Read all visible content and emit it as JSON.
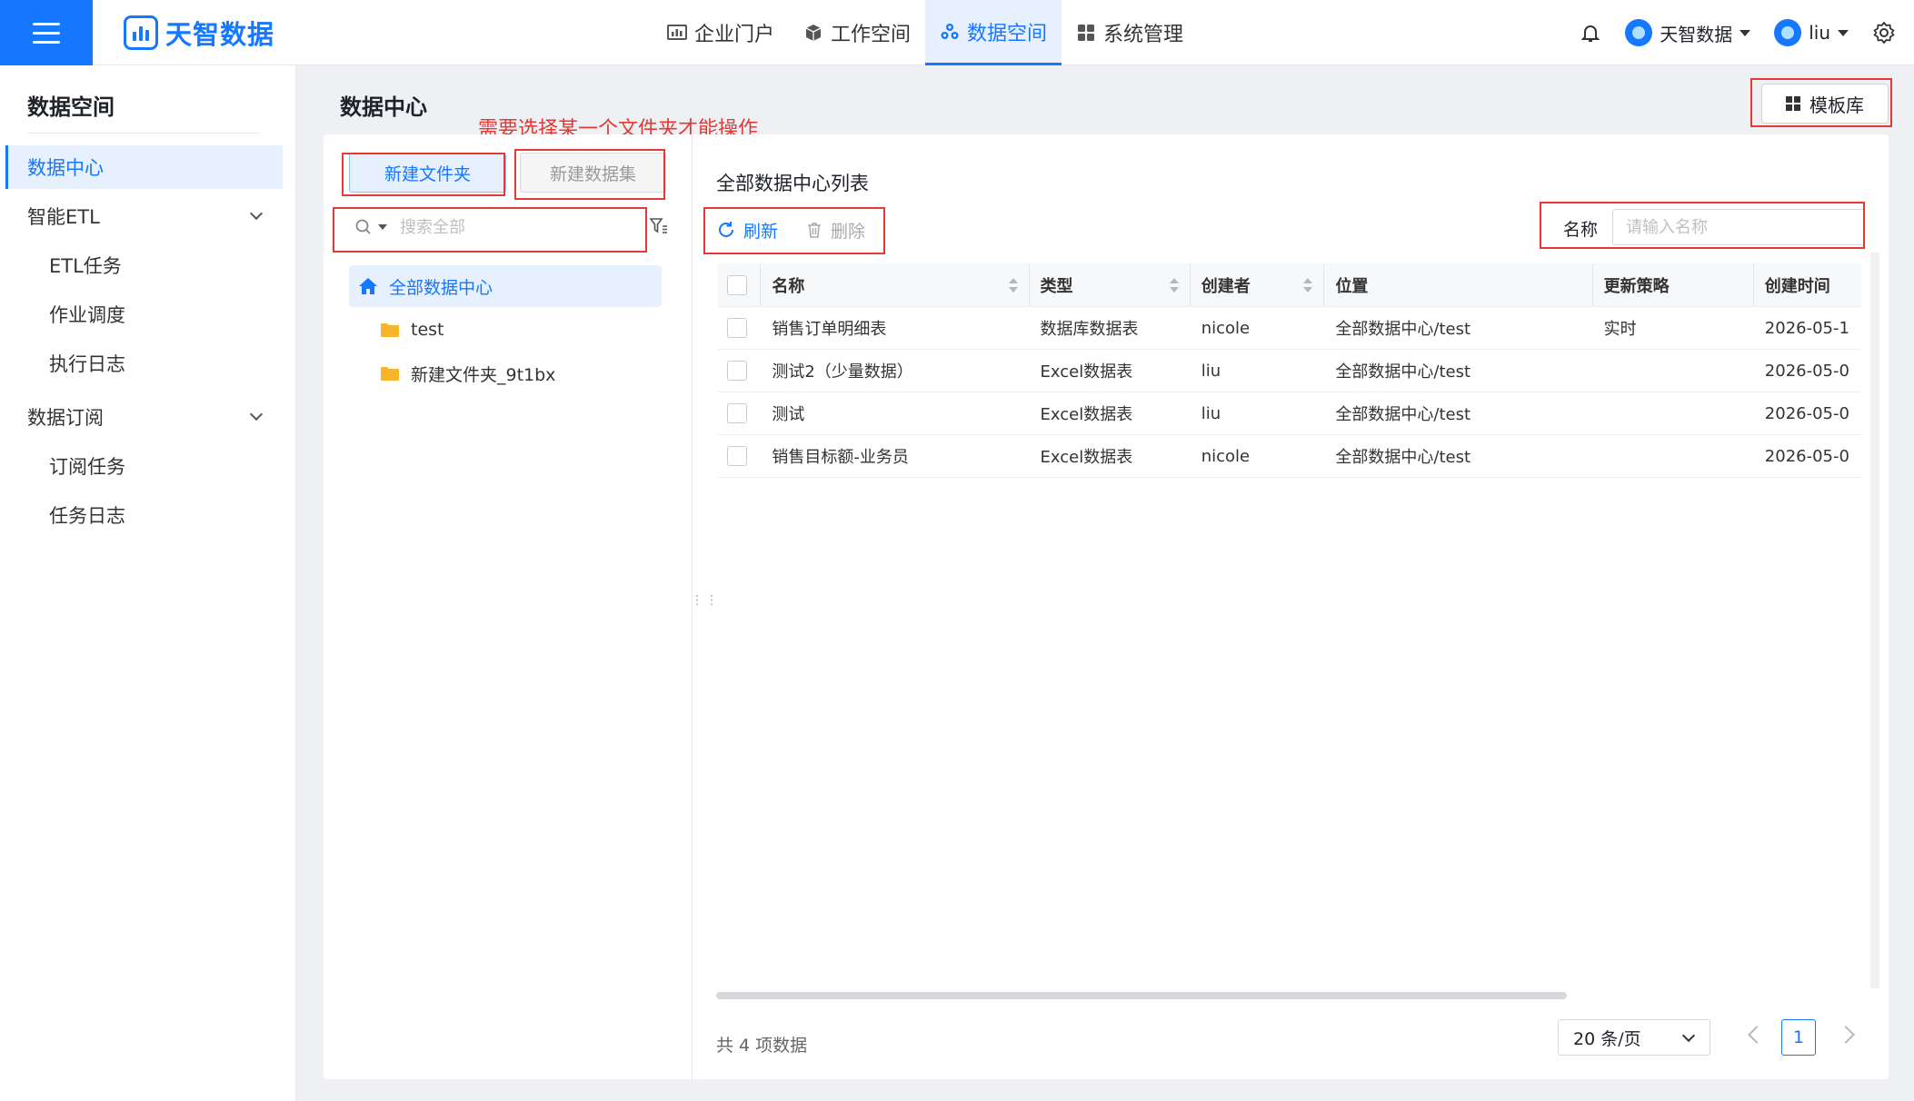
{
  "brand": {
    "name": "天智数据"
  },
  "topnav": [
    {
      "label": "企业门户",
      "icon": "chart-icon"
    },
    {
      "label": "工作空间",
      "icon": "cube-icon"
    },
    {
      "label": "数据空间",
      "icon": "cluster-icon",
      "active": true
    },
    {
      "label": "系统管理",
      "icon": "grid-icon"
    }
  ],
  "header_right": {
    "org": "天智数据",
    "user": "liu"
  },
  "sidebar": {
    "title": "数据空间",
    "items": [
      {
        "label": "数据中心",
        "active": true
      },
      {
        "label": "智能ETL",
        "expandable": true
      },
      {
        "label": "ETL任务",
        "sub": true
      },
      {
        "label": "作业调度",
        "sub": true
      },
      {
        "label": "执行日志",
        "sub": true
      },
      {
        "label": "数据订阅",
        "expandable": true
      },
      {
        "label": "订阅任务",
        "sub": true
      },
      {
        "label": "任务日志",
        "sub": true
      }
    ]
  },
  "page": {
    "title": "数据中心",
    "template_button": "模板库",
    "hint": "需要选择某一个文件夹才能操作"
  },
  "left_pane": {
    "new_folder": "新建文件夹",
    "new_dataset": "新建数据集",
    "search_placeholder": "搜索全部",
    "tree": [
      {
        "label": "全部数据中心",
        "icon": "home-icon",
        "active": true
      },
      {
        "label": "test",
        "icon": "folder-icon"
      },
      {
        "label": "新建文件夹_9t1bx",
        "icon": "folder-icon"
      }
    ]
  },
  "list": {
    "title": "全部数据中心列表",
    "refresh": "刷新",
    "delete": "删除",
    "name_label": "名称",
    "name_placeholder": "请输入名称",
    "columns": [
      "名称",
      "类型",
      "创建者",
      "位置",
      "更新策略",
      "创建时间"
    ],
    "rows": [
      [
        "销售订单明细表",
        "数据库数据表",
        "nicole",
        "全部数据中心/test",
        "实时",
        "2026-05-1"
      ],
      [
        "测试2（少量数据）",
        "Excel数据表",
        "liu",
        "全部数据中心/test",
        "",
        "2026-05-0"
      ],
      [
        "测试",
        "Excel数据表",
        "liu",
        "全部数据中心/test",
        "",
        "2026-05-0"
      ],
      [
        "销售目标额-业务员",
        "Excel数据表",
        "nicole",
        "全部数据中心/test",
        "",
        "2026-05-0"
      ]
    ],
    "total": "共 4 项数据",
    "page_size": "20 条/页",
    "current_page": "1"
  },
  "colors": {
    "accent": "#1677ff",
    "annotation": "#e53935",
    "folder": "#f7b52c"
  }
}
